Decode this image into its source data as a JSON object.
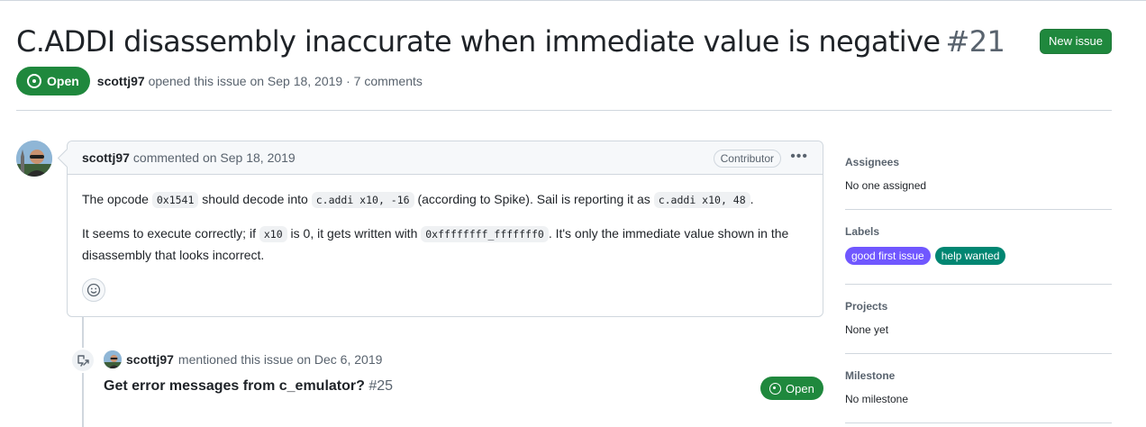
{
  "issue": {
    "title": "C.ADDI disassembly inaccurate when immediate value is negative",
    "number": "#21",
    "state": "Open",
    "author": "scottj97",
    "opened_text": "opened this issue on Sep 18, 2019 · 7 comments"
  },
  "header": {
    "new_issue_label": "New issue"
  },
  "comment": {
    "author": "scottj97",
    "when": "commented on Sep 18, 2019",
    "badge": "Contributor",
    "menu_glyph": "•••",
    "p1_before": "The opcode ",
    "p1_code1": "0x1541",
    "p1_mid1": " should decode into ",
    "p1_code2": "c.addi x10, -16",
    "p1_mid2": " (according to Spike). Sail is reporting it as ",
    "p1_code3": "c.addi x10, 48",
    "p1_after": ".",
    "p2_before": "It seems to execute correctly; if ",
    "p2_code1": "x10",
    "p2_mid1": " is 0, it gets written with ",
    "p2_code2": "0xffffffff_fffffff0",
    "p2_after": ". It's only the immediate value shown in the disassembly that looks incorrect."
  },
  "event": {
    "author": "scottj97",
    "text": "mentioned this issue on Dec 6, 2019",
    "ref_title": "Get error messages from c_emulator?",
    "ref_number": "#25",
    "ref_state": "Open"
  },
  "sidebar": {
    "assignees": {
      "heading": "Assignees",
      "value": "No one assigned"
    },
    "labels": {
      "heading": "Labels",
      "items": [
        {
          "name": "good first issue",
          "color": "#7057ff"
        },
        {
          "name": "help wanted",
          "color": "#008672"
        }
      ]
    },
    "projects": {
      "heading": "Projects",
      "value": "None yet"
    },
    "milestone": {
      "heading": "Milestone",
      "value": "No milestone"
    }
  },
  "colors": {
    "open_green": "#1f883d",
    "muted_text": "#59636e",
    "border": "#d0d7de"
  }
}
